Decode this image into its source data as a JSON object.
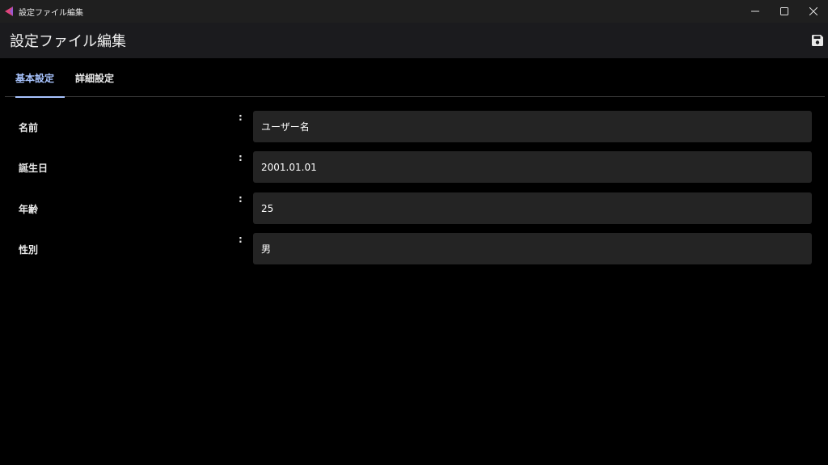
{
  "window": {
    "title": "設定ファイル編集",
    "controls": {
      "minimize": "—",
      "maximize": "☐",
      "close": "✕"
    }
  },
  "appbar": {
    "title": "設定ファイル編集",
    "save_icon": "save-icon"
  },
  "tabs": [
    {
      "label": "基本設定",
      "active": true
    },
    {
      "label": "詳細設定",
      "active": false
    }
  ],
  "form": {
    "separator": ":",
    "fields": [
      {
        "label": "名前",
        "value": "ユーザー名"
      },
      {
        "label": "誕生日",
        "value": "2001.01.01"
      },
      {
        "label": "年齢",
        "value": "25"
      },
      {
        "label": "性別",
        "value": "男"
      }
    ]
  },
  "colors": {
    "background": "#000000",
    "titlebar": "#1f1f1f",
    "appbar": "#1b1b1e",
    "accent": "#a8c4ff",
    "input_bg": "#242424",
    "app_icon_primary": "#e0457b",
    "app_icon_secondary": "#9b59d0"
  }
}
